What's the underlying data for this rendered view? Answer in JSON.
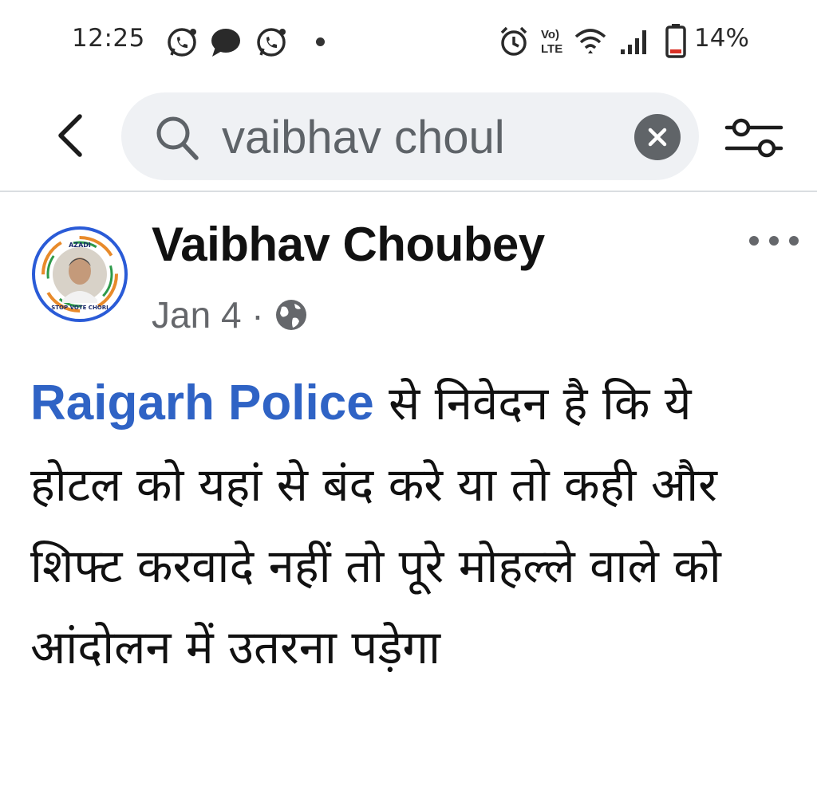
{
  "status_bar": {
    "time": "12:25",
    "battery": "14%",
    "icons": [
      "whatsapp-icon",
      "chat-bubble-icon",
      "whatsapp-icon",
      "notification-dot",
      "alarm-icon",
      "volte-icon",
      "wifi-icon",
      "signal-icon",
      "battery-icon"
    ]
  },
  "search": {
    "query": "vaibhav choul",
    "icons": [
      "back-arrow-icon",
      "search-icon",
      "clear-icon",
      "filter-icon"
    ]
  },
  "post": {
    "author": "Vaibhav Choubey",
    "date": "Jan 4",
    "separator": " · ",
    "privacy_icon": "globe-icon",
    "avatar_text_top": "AZADI",
    "avatar_text_bottom": "STOP VOTE CHORI",
    "mention": "Raigarh Police",
    "body_text": " से निवेदन है कि ये होटल को यहां से बंद करे या तो कही और शिफ्ट करवादे नहीं तो पूरे मोहल्ले वाले को आंदोलन में उतरना पड़ेगा"
  },
  "colors": {
    "mention": "#2f63c5",
    "avatar_ring": "#2a5bd7",
    "search_bg": "#eff1f4",
    "meta_text": "#65676b",
    "battery_low": "#d93025"
  }
}
